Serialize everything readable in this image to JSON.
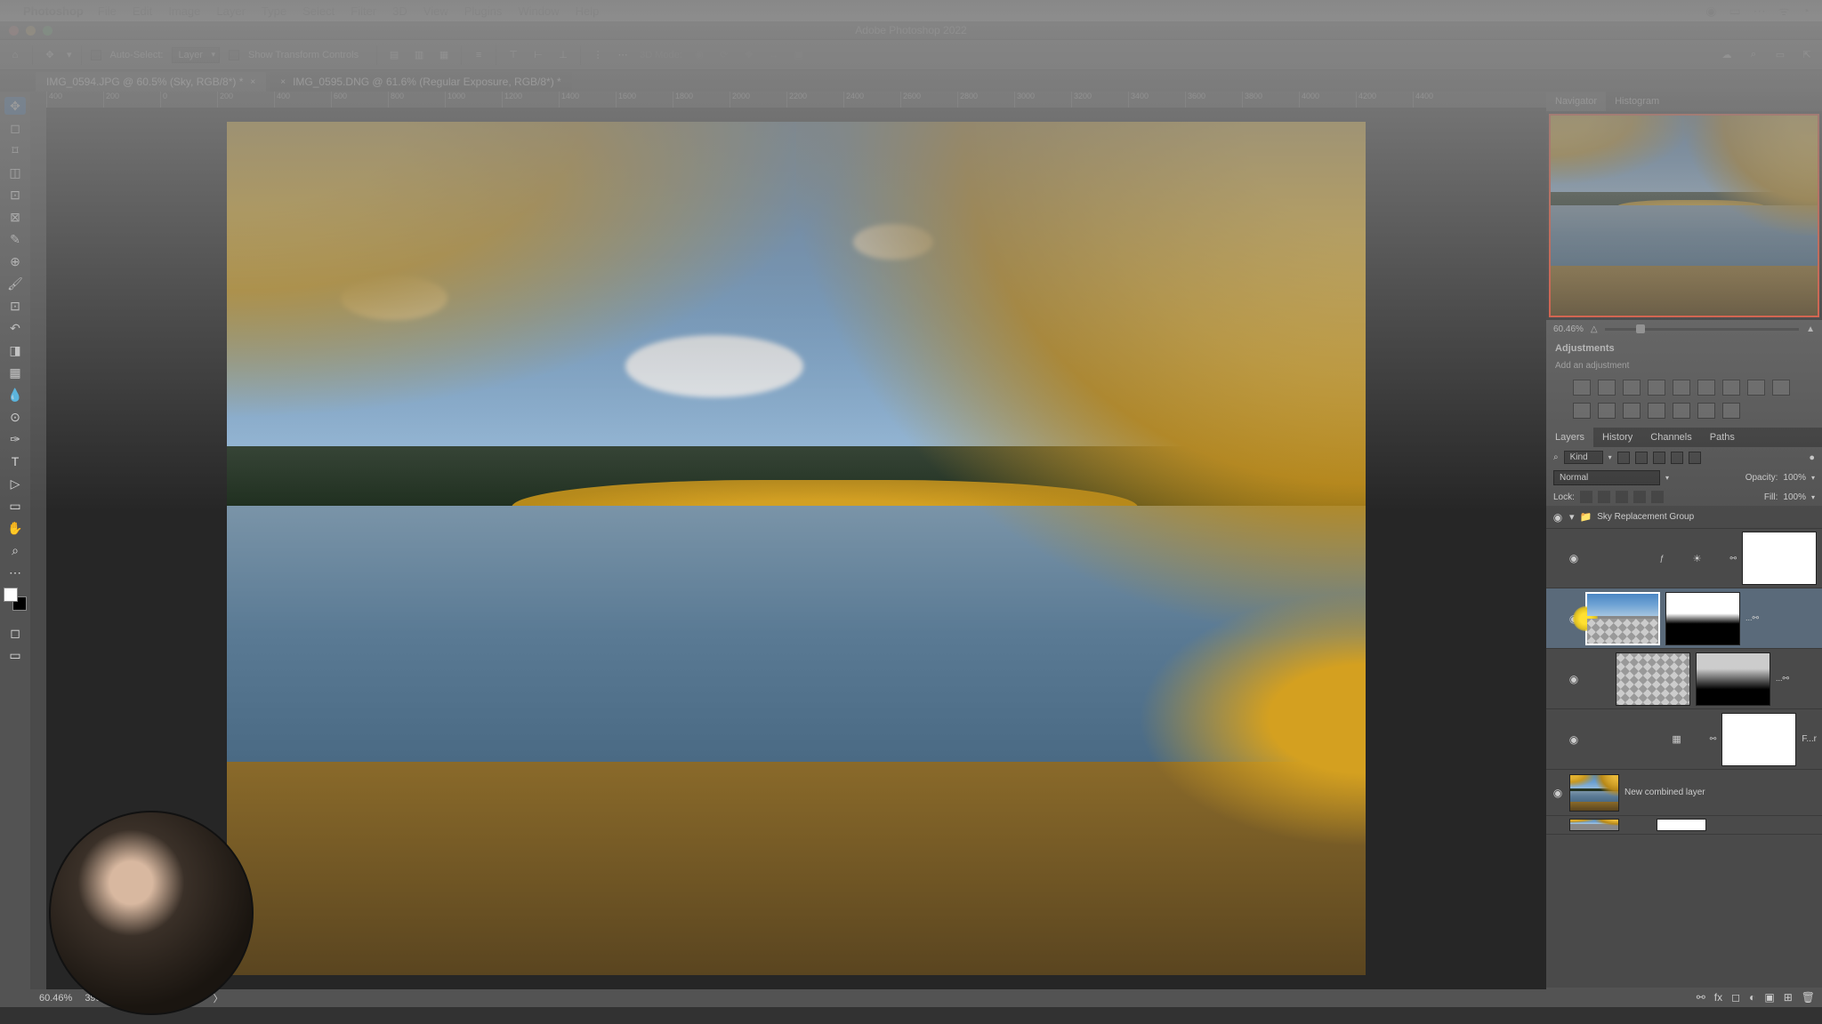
{
  "mac_menu": {
    "app": "Photoshop",
    "items": [
      "File",
      "Edit",
      "Image",
      "Layer",
      "Type",
      "Select",
      "Filter",
      "3D",
      "View",
      "Plugins",
      "Window",
      "Help"
    ]
  },
  "titlebar": {
    "title": "Adobe Photoshop 2022"
  },
  "options_bar": {
    "auto_select_label": "Auto-Select:",
    "auto_select_target": "Layer",
    "show_transform": "Show Transform Controls",
    "mode_3d": "3D Mode:"
  },
  "document_tabs": [
    {
      "label": "IMG_0594.JPG @ 60.5% (Sky, RGB/8*) *"
    },
    {
      "label": "IMG_0595.DNG @ 61.6% (Regular Exposure, RGB/8*) *"
    }
  ],
  "ruler_ticks": [
    "400",
    "200",
    "0",
    "200",
    "400",
    "600",
    "800",
    "1000",
    "1200",
    "1400",
    "1600",
    "1800",
    "2000",
    "2200",
    "2400",
    "2600",
    "2800",
    "3000",
    "3200",
    "3400",
    "3600",
    "3800",
    "4000",
    "4200",
    "4400"
  ],
  "status": {
    "zoom": "60.46%",
    "doc_info": "3990 px x 2994 px (72 ppi)"
  },
  "panels": {
    "navigator_tabs": [
      "Navigator",
      "Histogram"
    ],
    "nav_zoom": "60.46%",
    "adjustments_title": "Adjustments",
    "adjustments_label": "Add an adjustment",
    "layers_tabs": [
      "Layers",
      "History",
      "Channels",
      "Paths"
    ],
    "kind": "Kind",
    "blend_mode": "Normal",
    "opacity_label": "Opacity:",
    "opacity_value": "100%",
    "lock_label": "Lock:",
    "fill_label": "Fill:",
    "fill_value": "100%",
    "layers": {
      "group_name": "Sky Replacement Group",
      "bottom_name": "New combined layer",
      "filter_badge": "F...r"
    }
  }
}
